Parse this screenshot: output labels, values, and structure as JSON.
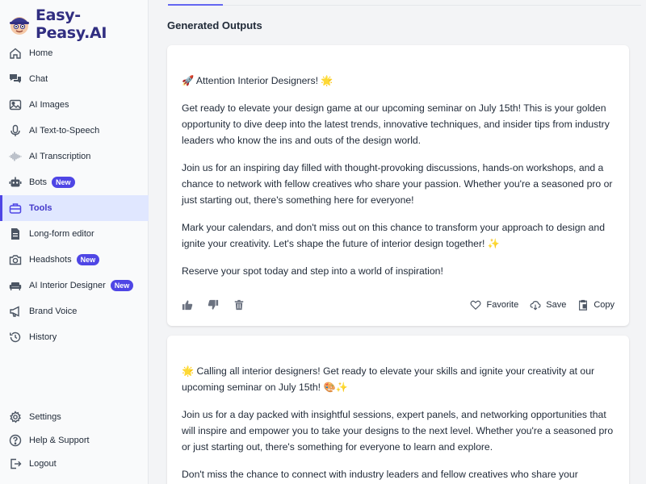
{
  "app": {
    "name": "Easy-Peasy.AI"
  },
  "sidebar": {
    "items": [
      {
        "label": "Home",
        "icon": "home-icon"
      },
      {
        "label": "Chat",
        "icon": "chat-icon"
      },
      {
        "label": "AI Images",
        "icon": "image-icon"
      },
      {
        "label": "AI Text-to-Speech",
        "icon": "microphone-icon"
      },
      {
        "label": "AI Transcription",
        "icon": "waveform-icon"
      },
      {
        "label": "Bots",
        "icon": "bot-icon",
        "badge": "New"
      },
      {
        "label": "Tools",
        "icon": "briefcase-icon",
        "active": true
      },
      {
        "label": "Long-form editor",
        "icon": "document-icon"
      },
      {
        "label": "Headshots",
        "icon": "camera-icon",
        "badge": "New"
      },
      {
        "label": "AI Interior Designer",
        "icon": "sofa-icon",
        "badge": "New"
      },
      {
        "label": "Brand Voice",
        "icon": "megaphone-icon"
      },
      {
        "label": "History",
        "icon": "history-icon"
      }
    ],
    "bottom": [
      {
        "label": "Settings",
        "icon": "gear-icon"
      },
      {
        "label": "Help & Support",
        "icon": "question-icon"
      },
      {
        "label": "Logout",
        "icon": "logout-icon"
      }
    ]
  },
  "main": {
    "section_title": "Generated Outputs",
    "outputs": [
      {
        "paragraphs": [
          "🚀 Attention Interior Designers! 🌟",
          "Get ready to elevate your design game at our upcoming seminar on July 15th! This is your golden opportunity to dive deep into the latest trends, innovative techniques, and insider tips from industry leaders who know the ins and outs of the design world.",
          "Join us for an inspiring day filled with thought-provoking discussions, hands-on workshops, and a chance to network with fellow creatives who share your passion. Whether you're a seasoned pro or just starting out, there's something here for everyone!",
          "Mark your calendars, and don't miss out on this chance to transform your approach to design and ignite your creativity. Let's shape the future of interior design together! ✨",
          "Reserve your spot today and step into a world of inspiration!"
        ],
        "actions": {
          "favorite": "Favorite",
          "save": "Save",
          "copy": "Copy"
        }
      },
      {
        "paragraphs": [
          "🌟 Calling all interior designers! Get ready to elevate your skills and ignite your creativity at our upcoming seminar on July 15th! 🎨✨",
          "Join us for a day packed with insightful sessions, expert panels, and networking opportunities that will inspire and empower you to take your designs to the next level. Whether you're a seasoned pro or just starting out, there's something for everyone to learn and explore.",
          "Don't miss the chance to connect with industry leaders and fellow creatives who share your"
        ]
      }
    ]
  },
  "colors": {
    "accent": "#4f46e5",
    "brand_text": "#312e81",
    "active_bg": "#e0e7ff"
  }
}
